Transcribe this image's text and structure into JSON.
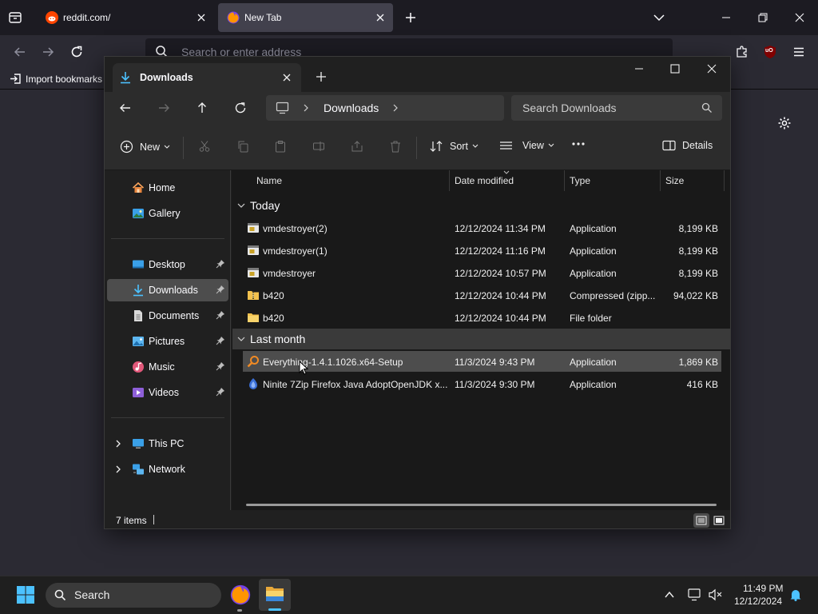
{
  "colors": {
    "accent": "#4cc2ff",
    "explorer_bg": "#202020",
    "selection": "#4d4d4d",
    "firefox_bg": "#2b2a33",
    "folder": "#f2c14e"
  },
  "browser": {
    "tabs": [
      {
        "title": "reddit.com/",
        "icon": "reddit-icon",
        "active": false
      },
      {
        "title": "New Tab",
        "icon": "firefox-icon",
        "active": true
      }
    ],
    "address_placeholder": "Search or enter address",
    "bookmarks_import_label": "Import bookmarks",
    "extension_badge": "uO"
  },
  "explorer": {
    "tab_title": "Downloads",
    "breadcrumb": [
      "Downloads"
    ],
    "search_placeholder": "Search Downloads",
    "commands": {
      "new": "New",
      "sort": "Sort",
      "view": "View",
      "details": "Details"
    },
    "nav": {
      "quick": [
        {
          "label": "Home",
          "icon": "home-icon"
        },
        {
          "label": "Gallery",
          "icon": "gallery-icon"
        }
      ],
      "pinned": [
        {
          "label": "Desktop",
          "icon": "desktop-icon"
        },
        {
          "label": "Downloads",
          "icon": "downloads-icon",
          "selected": true
        },
        {
          "label": "Documents",
          "icon": "documents-icon"
        },
        {
          "label": "Pictures",
          "icon": "pictures-icon"
        },
        {
          "label": "Music",
          "icon": "music-icon"
        },
        {
          "label": "Videos",
          "icon": "videos-icon"
        }
      ],
      "locations": [
        {
          "label": "This PC",
          "icon": "this-pc-icon"
        },
        {
          "label": "Network",
          "icon": "network-icon"
        }
      ]
    },
    "columns": [
      "Name",
      "Date modified",
      "Type",
      "Size"
    ],
    "groups": [
      {
        "label": "Today",
        "rows": [
          {
            "name": "vmdestroyer(2)",
            "date": "12/12/2024 11:34 PM",
            "type": "Application",
            "size": "8,199 KB",
            "icon": "app-icon"
          },
          {
            "name": "vmdestroyer(1)",
            "date": "12/12/2024 11:16 PM",
            "type": "Application",
            "size": "8,199 KB",
            "icon": "app-icon"
          },
          {
            "name": "vmdestroyer",
            "date": "12/12/2024 10:57 PM",
            "type": "Application",
            "size": "8,199 KB",
            "icon": "app-icon"
          },
          {
            "name": "b420",
            "date": "12/12/2024 10:44 PM",
            "type": "Compressed (zipp...",
            "size": "94,022 KB",
            "icon": "zip-folder-icon"
          },
          {
            "name": "b420",
            "date": "12/12/2024 10:44 PM",
            "type": "File folder",
            "size": "",
            "icon": "folder-icon"
          }
        ]
      },
      {
        "label": "Last month",
        "rows": [
          {
            "name": "Everything-1.4.1.1026.x64-Setup",
            "date": "11/3/2024 9:43 PM",
            "type": "Application",
            "size": "1,869 KB",
            "icon": "everything-icon",
            "selected": true
          },
          {
            "name": "Ninite 7Zip Firefox Java AdoptOpenJDK x...",
            "date": "11/3/2024 9:30 PM",
            "type": "Application",
            "size": "416 KB",
            "icon": "ninite-icon"
          }
        ]
      }
    ],
    "status": "7 items"
  },
  "taskbar": {
    "search_label": "Search",
    "time": "11:49 PM",
    "date": "12/12/2024"
  }
}
